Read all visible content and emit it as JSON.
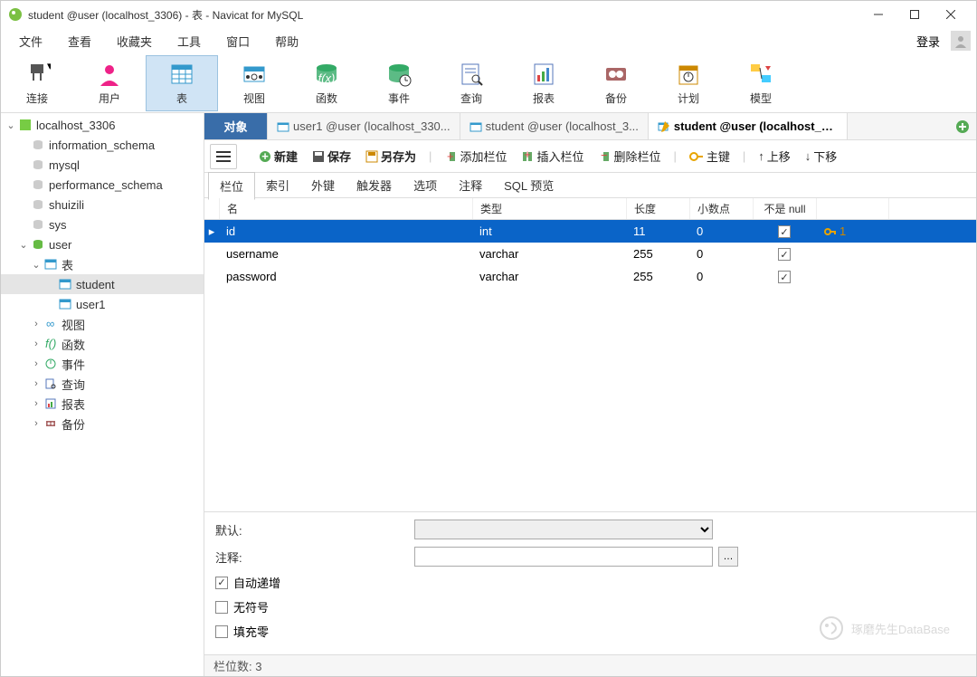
{
  "window": {
    "title": "student @user (localhost_3306) - 表 - Navicat for MySQL"
  },
  "menu": {
    "items": [
      "文件",
      "查看",
      "收藏夹",
      "工具",
      "窗口",
      "帮助"
    ],
    "login": "登录"
  },
  "toolbar": [
    {
      "label": "连接",
      "icon": "plug"
    },
    {
      "label": "用户",
      "icon": "user"
    },
    {
      "label": "表",
      "icon": "table",
      "active": true
    },
    {
      "label": "视图",
      "icon": "view"
    },
    {
      "label": "函数",
      "icon": "fx"
    },
    {
      "label": "事件",
      "icon": "event"
    },
    {
      "label": "查询",
      "icon": "query"
    },
    {
      "label": "报表",
      "icon": "report"
    },
    {
      "label": "备份",
      "icon": "backup"
    },
    {
      "label": "计划",
      "icon": "schedule"
    },
    {
      "label": "模型",
      "icon": "model"
    }
  ],
  "tree": [
    {
      "label": "localhost_3306",
      "icon": "db-conn",
      "expand": "open",
      "level": 0
    },
    {
      "label": "information_schema",
      "icon": "db",
      "level": 1
    },
    {
      "label": "mysql",
      "icon": "db",
      "level": 1
    },
    {
      "label": "performance_schema",
      "icon": "db",
      "level": 1
    },
    {
      "label": "shuizili",
      "icon": "db",
      "level": 1
    },
    {
      "label": "sys",
      "icon": "db",
      "level": 1
    },
    {
      "label": "user",
      "icon": "db-active",
      "expand": "open",
      "level": 1
    },
    {
      "label": "表",
      "icon": "tables",
      "expand": "open",
      "level": 2
    },
    {
      "label": "student",
      "icon": "table",
      "level": 3,
      "selected": true
    },
    {
      "label": "user1",
      "icon": "table",
      "level": 3
    },
    {
      "label": "视图",
      "icon": "view-s",
      "expand": "closed",
      "level": 2
    },
    {
      "label": "函数",
      "icon": "fx-s",
      "expand": "closed",
      "level": 2
    },
    {
      "label": "事件",
      "icon": "event-s",
      "expand": "closed",
      "level": 2
    },
    {
      "label": "查询",
      "icon": "query-s",
      "expand": "closed",
      "level": 2
    },
    {
      "label": "报表",
      "icon": "report-s",
      "expand": "closed",
      "level": 2
    },
    {
      "label": "备份",
      "icon": "backup-s",
      "expand": "closed",
      "level": 2
    }
  ],
  "tabs": {
    "object": "对象",
    "items": [
      {
        "label": "user1 @user (localhost_330..."
      },
      {
        "label": "student @user (localhost_3..."
      },
      {
        "label": "student @user (localhost_33...",
        "active": true,
        "edit": true
      }
    ]
  },
  "actions": {
    "new": "新建",
    "save": "保存",
    "saveas": "另存为",
    "addfield": "添加栏位",
    "insertfield": "插入栏位",
    "deletefield": "删除栏位",
    "primarykey": "主键",
    "moveup": "上移",
    "movedown": "下移"
  },
  "subtabs": [
    "栏位",
    "索引",
    "外键",
    "触发器",
    "选项",
    "注释",
    "SQL 预览"
  ],
  "columns": {
    "name": "名",
    "type": "类型",
    "length": "长度",
    "decimals": "小数点",
    "notnull": "不是 null",
    "key": ""
  },
  "rows": [
    {
      "name": "id",
      "type": "int",
      "length": "11",
      "decimals": "0",
      "notnull": true,
      "pk": "1",
      "selected": true
    },
    {
      "name": "username",
      "type": "varchar",
      "length": "255",
      "decimals": "0",
      "notnull": true
    },
    {
      "name": "password",
      "type": "varchar",
      "length": "255",
      "decimals": "0",
      "notnull": true
    }
  ],
  "props": {
    "default_label": "默认:",
    "comment_label": "注释:",
    "auto_increment": "自动递增",
    "auto_increment_checked": true,
    "unsigned": "无符号",
    "unsigned_checked": false,
    "zerofill": "填充零",
    "zerofill_checked": false
  },
  "status": {
    "field_count_label": "栏位数: 3"
  },
  "watermark": "琢磨先生DataBase"
}
